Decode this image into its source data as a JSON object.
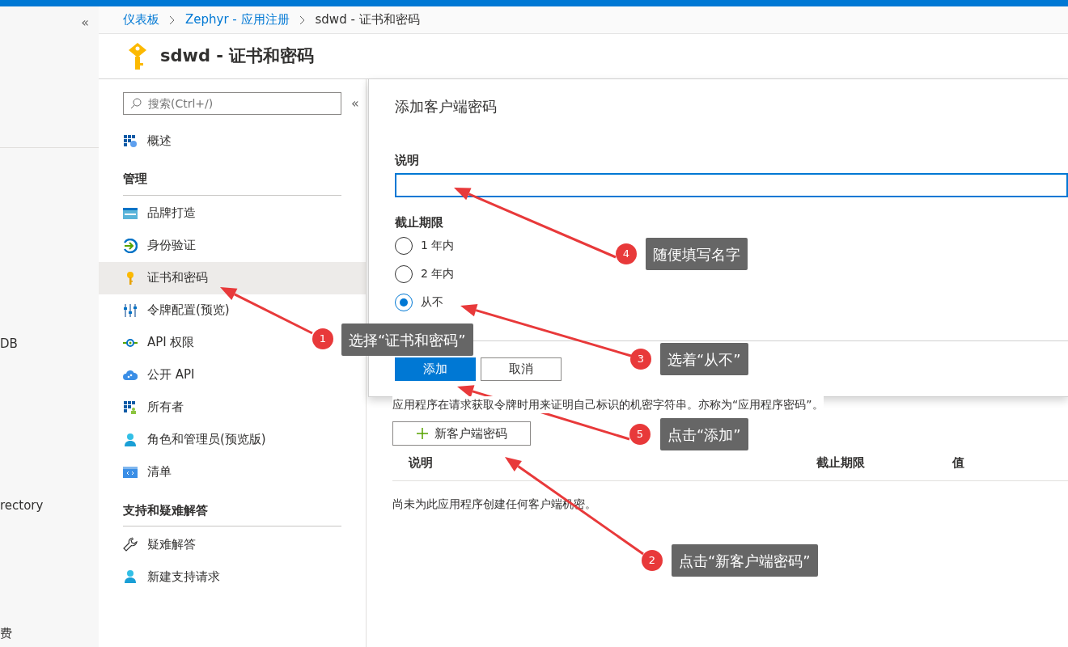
{
  "left_nav": {
    "collapse": "«",
    "fragments": [
      "DB",
      "rectory",
      "费"
    ]
  },
  "breadcrumb": [
    {
      "label": "仪表板",
      "link": true
    },
    {
      "label": "Zephyr - 应用注册",
      "link": true
    },
    {
      "label": "sdwd - 证书和密码",
      "link": false
    }
  ],
  "page_title": "sdwd - 证书和密码",
  "menu": {
    "search_placeholder": "搜索(Ctrl+/)",
    "collapse": "«",
    "sections": [
      {
        "items": [
          {
            "label": "概述",
            "selected": false
          }
        ]
      },
      {
        "heading": "管理",
        "items": [
          {
            "label": "品牌打造",
            "selected": false
          },
          {
            "label": "身份验证",
            "selected": false
          },
          {
            "label": "证书和密码",
            "selected": true
          },
          {
            "label": "令牌配置(预览)",
            "selected": false
          },
          {
            "label": "API 权限",
            "selected": false
          },
          {
            "label": "公开 API",
            "selected": false
          },
          {
            "label": "所有者",
            "selected": false
          },
          {
            "label": "角色和管理员(预览版)",
            "selected": false
          },
          {
            "label": "清单",
            "selected": false
          }
        ]
      },
      {
        "heading": "支持和疑难解答",
        "items": [
          {
            "label": "疑难解答",
            "selected": false
          },
          {
            "label": "新建支持请求",
            "selected": false
          }
        ]
      }
    ]
  },
  "content": {
    "description": "应用程序在请求获取令牌时用来证明自己标识的机密字符串。亦称为“应用程序密码”。",
    "new_button": "新客户端密码",
    "columns": [
      "说明",
      "截止期限",
      "值"
    ],
    "empty_message": "尚未为此应用程序创建任何客户端机密。"
  },
  "panel": {
    "title": "添加客户端密码",
    "description_label": "说明",
    "expiry_label": "截止期限",
    "options": [
      {
        "label": "1 年内",
        "selected": false
      },
      {
        "label": "2 年内",
        "selected": false
      },
      {
        "label": "从不",
        "selected": true
      }
    ],
    "buttons": [
      {
        "label": "添加",
        "kind": "primary"
      },
      {
        "label": "取消",
        "kind": "secondary"
      }
    ]
  },
  "annotations": [
    {
      "number": "4",
      "text": "随便填写名字"
    },
    {
      "number": "1",
      "text": "选择“证书和密码”"
    },
    {
      "number": "3",
      "text": "选着“从不”"
    },
    {
      "number": "5",
      "text": "点击“添加”"
    },
    {
      "number": "2",
      "text": "点击“新客户端密码”"
    }
  ]
}
